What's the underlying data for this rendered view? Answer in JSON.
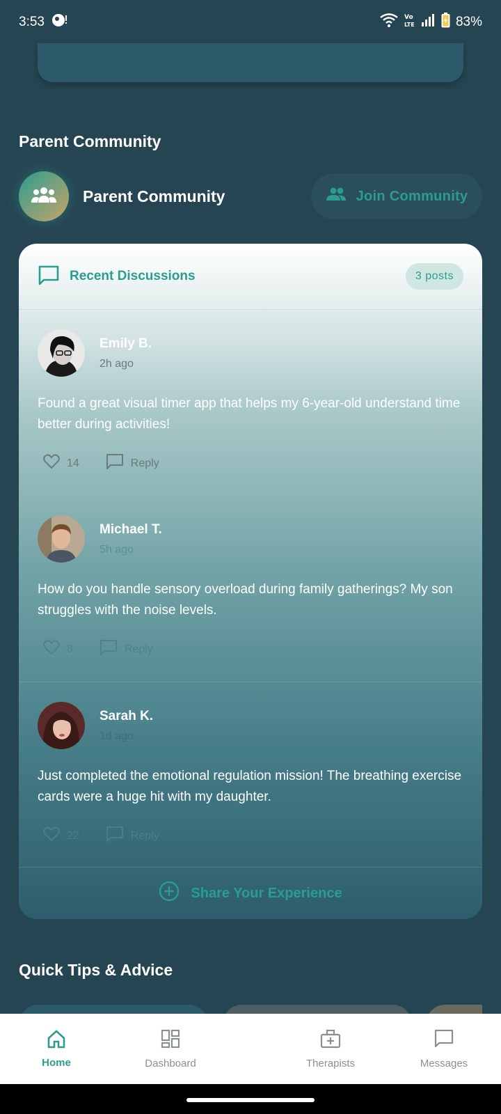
{
  "status_bar": {
    "time": "3:53",
    "battery": "83%"
  },
  "community": {
    "section_title": "Parent Community",
    "name": "Parent Community",
    "join_label": "Join Community"
  },
  "discussions": {
    "title": "Recent Discussions",
    "count_label": "3 posts",
    "posts": [
      {
        "author": "Emily B.",
        "time": "2h ago",
        "text": "Found a great visual timer app that helps my 6-year-old understand time better during activities!",
        "likes": "14",
        "reply_label": "Reply"
      },
      {
        "author": "Michael T.",
        "time": "5h ago",
        "text": "How do you handle sensory overload during family gatherings? My son struggles with the noise levels.",
        "likes": "8",
        "reply_label": "Reply"
      },
      {
        "author": "Sarah K.",
        "time": "1d ago",
        "text": "Just completed the emotional regulation mission! The breathing exercise cards were a huge hit with my daughter.",
        "likes": "22",
        "reply_label": "Reply"
      }
    ],
    "share_label": "Share Your Experience"
  },
  "tips": {
    "title": "Quick Tips & Advice"
  },
  "bottom_nav": {
    "items": [
      {
        "label": "Home",
        "icon": "home-icon"
      },
      {
        "label": "Dashboard",
        "icon": "dashboard-icon"
      },
      {
        "label": "Therapists",
        "icon": "medical-bag-icon"
      },
      {
        "label": "Messages",
        "icon": "chat-icon"
      }
    ],
    "active": "Home"
  },
  "colors": {
    "background": "#264552",
    "accent": "#2a9d8f",
    "nav_inactive": "#8a8f93"
  }
}
